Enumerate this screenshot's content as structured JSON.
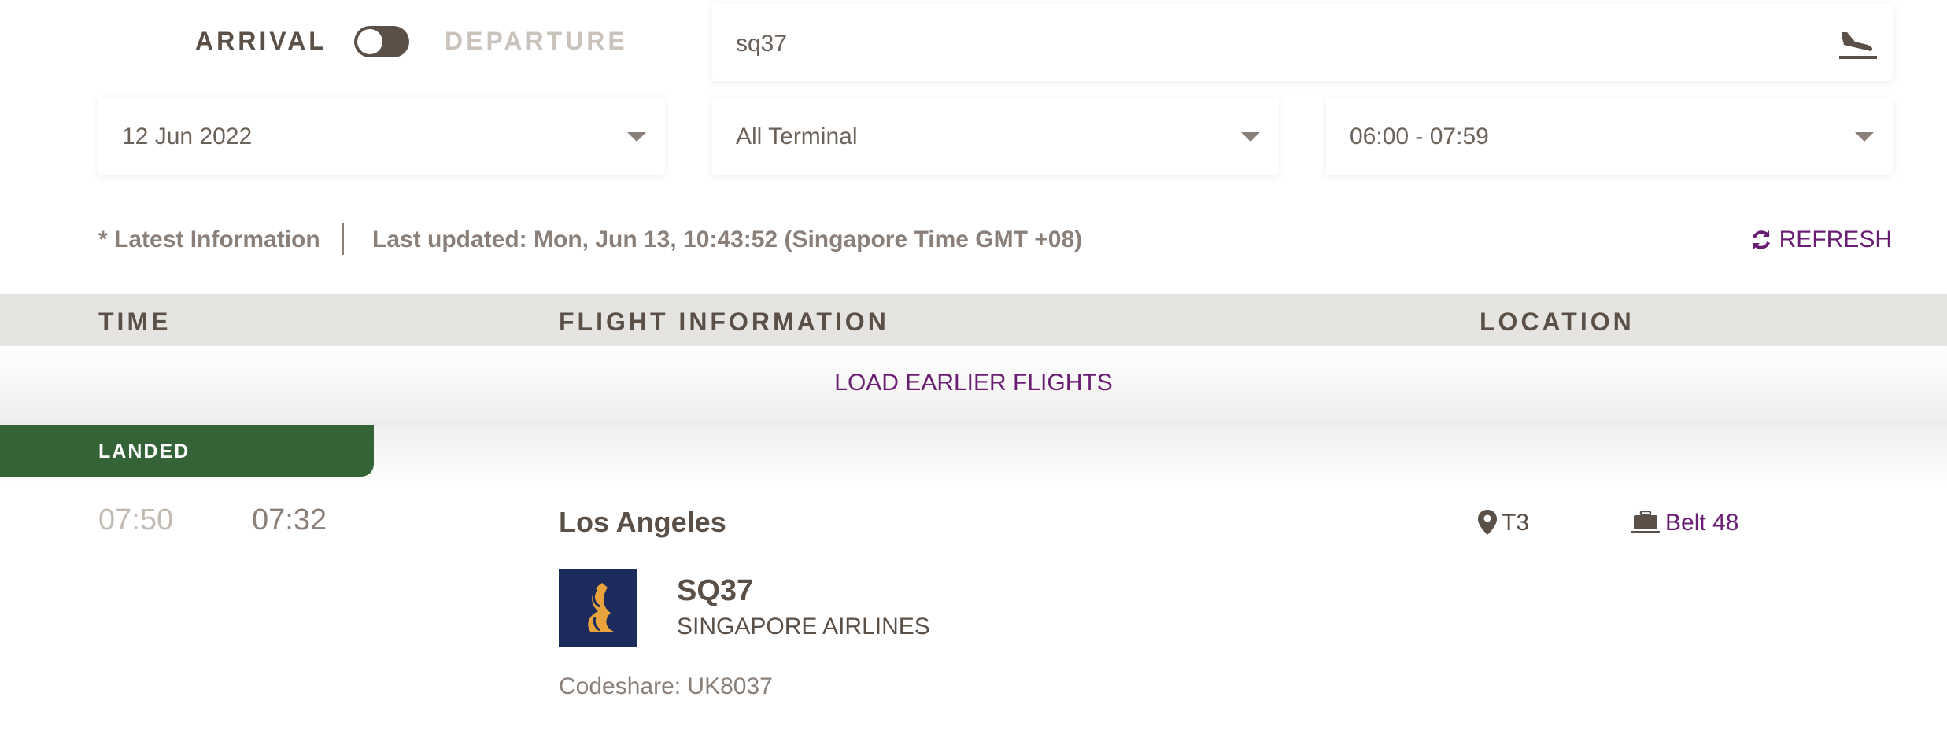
{
  "toggle": {
    "left_label": "ARRIVAL",
    "right_label": "DEPARTURE",
    "state": "arrival"
  },
  "search": {
    "value": "sq37"
  },
  "filters": {
    "date": "12 Jun 2022",
    "terminal": "All Terminal",
    "time_range": "06:00 - 07:59"
  },
  "info": {
    "latest": "* Latest Information",
    "updated": "Last updated: Mon, Jun 13, 10:43:52 (Singapore Time GMT +08)",
    "refresh_label": "REFRESH"
  },
  "table": {
    "headers": {
      "time": "TIME",
      "flight": "FLIGHT INFORMATION",
      "location": "LOCATION"
    },
    "load_earlier": "LOAD EARLIER FLIGHTS"
  },
  "flight": {
    "status": "LANDED",
    "scheduled_time": "07:50",
    "actual_time": "07:32",
    "origin": "Los Angeles",
    "flight_number": "SQ37",
    "airline": "SINGAPORE AIRLINES",
    "codeshare": "Codeshare: UK8037",
    "terminal": "T3",
    "belt": "Belt 48"
  },
  "colors": {
    "accent_purple": "#6a1e73",
    "status_green": "#356338",
    "header_bg": "#e6e4e0",
    "text_brown": "#5a5047",
    "logo_navy": "#1c2a5c",
    "logo_gold": "#e8a33c"
  }
}
